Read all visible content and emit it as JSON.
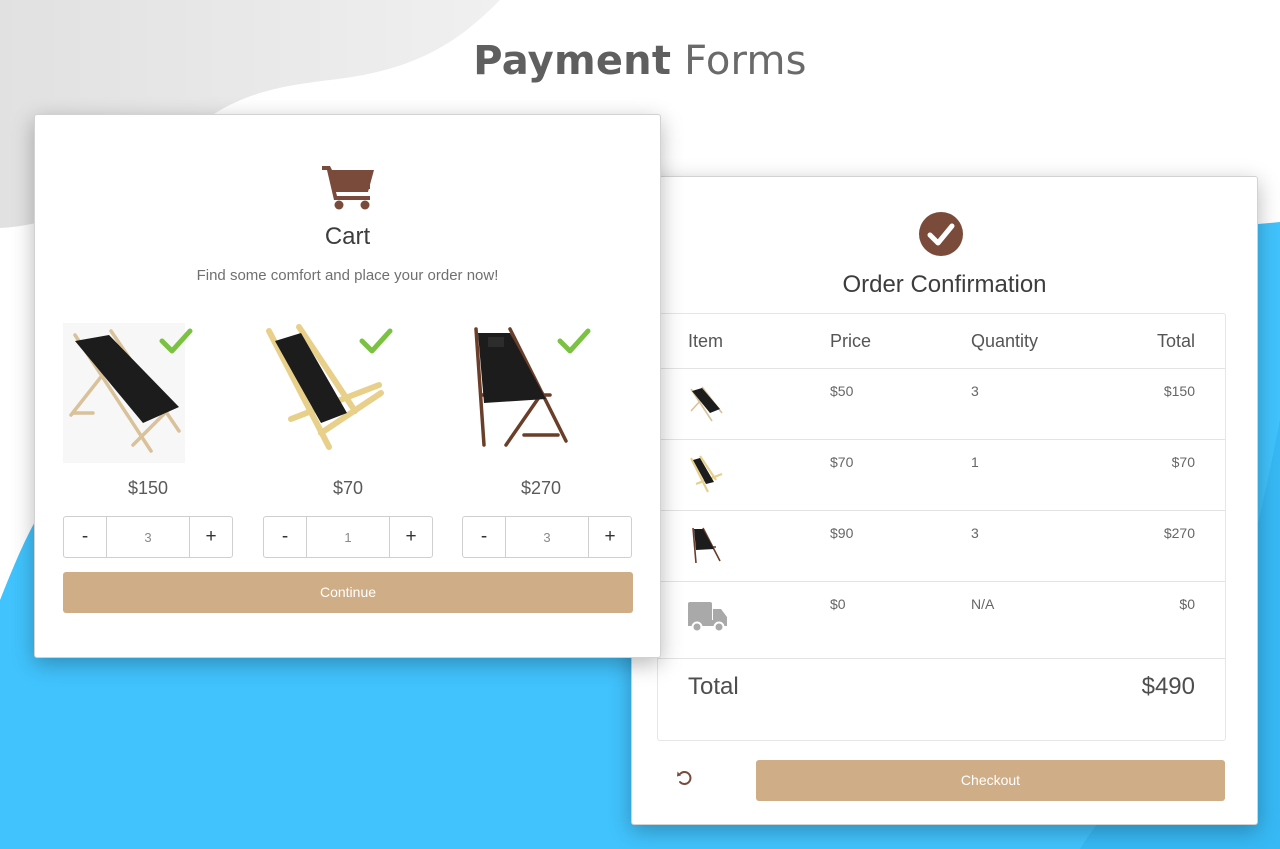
{
  "page": {
    "title_bold": "Payment",
    "title_light": "Forms"
  },
  "colors": {
    "accent_brown": "#7a4b3a",
    "button_tan": "#cfad86",
    "check_green": "#7bc142",
    "background_blue": "#41c3fd"
  },
  "cart": {
    "icon": "shopping-cart-icon",
    "title": "Cart",
    "subtitle": "Find some comfort and place your order now!",
    "products": [
      {
        "name": "natural-wood-black-chair",
        "price": "$150",
        "quantity": "3",
        "selected": true
      },
      {
        "name": "light-pine-black-chair",
        "price": "$70",
        "quantity": "1",
        "selected": true
      },
      {
        "name": "dark-wood-black-chair",
        "price": "$270",
        "quantity": "3",
        "selected": true
      }
    ],
    "minus_label": "-",
    "plus_label": "+",
    "continue_label": "Continue"
  },
  "order": {
    "icon": "check-circle-icon",
    "title": "Order Confirmation",
    "columns": [
      "Item",
      "Price",
      "Quantity",
      "Total"
    ],
    "rows": [
      {
        "item": "natural-wood-black-chair",
        "price": "$50",
        "quantity": "3",
        "total": "$150"
      },
      {
        "item": "light-pine-black-chair",
        "price": "$70",
        "quantity": "1",
        "total": "$70"
      },
      {
        "item": "dark-wood-black-chair",
        "price": "$90",
        "quantity": "3",
        "total": "$270"
      },
      {
        "item": "truck-icon",
        "price": "$0",
        "quantity": "N/A",
        "total": "$0"
      }
    ],
    "total_label": "Total",
    "total_value": "$490",
    "undo_icon": "undo-icon",
    "checkout_label": "Checkout"
  }
}
